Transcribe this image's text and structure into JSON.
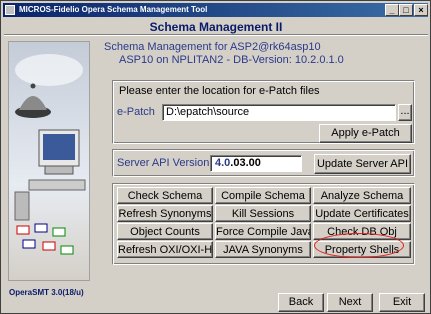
{
  "window": {
    "title": "MICROS-Fidelio Opera Schema Management Tool"
  },
  "header": {
    "title": "Schema Management II"
  },
  "info": {
    "line1": "Schema Management for ASP2@rk64asp10",
    "line2": "ASP10 on NPLITAN2 - DB-Version: 10.2.0.1.0"
  },
  "epatch": {
    "prompt": "Please enter the location for e-Patch files",
    "label": "e-Patch",
    "value": "D:\\epatch\\source",
    "browse_label": "...",
    "apply_label": "Apply e-Patch"
  },
  "server_api": {
    "label": "Server API Version",
    "version_major": "4.0",
    "version_minor": ".03.00",
    "update_label": "Update Server API"
  },
  "actions": [
    "Check Schema",
    "Compile Schema",
    "Analyze Schema",
    "Refresh Synonyms",
    "Kill Sessions",
    "Update Certificates",
    "Object Counts",
    "Force Compile Java",
    "Check DB Obj",
    "Refresh OXI/OXI-Hub",
    "JAVA Synonyms",
    "Property Shells"
  ],
  "footer": {
    "version": "OperaSMT 3.0(18/u)",
    "back_label": "Back",
    "next_label": "Next",
    "exit_label": "Exit"
  },
  "colors": {
    "title_bar": "#0a246a",
    "accent_text": "#2a3a8a",
    "highlight_circle": "#e02020"
  }
}
